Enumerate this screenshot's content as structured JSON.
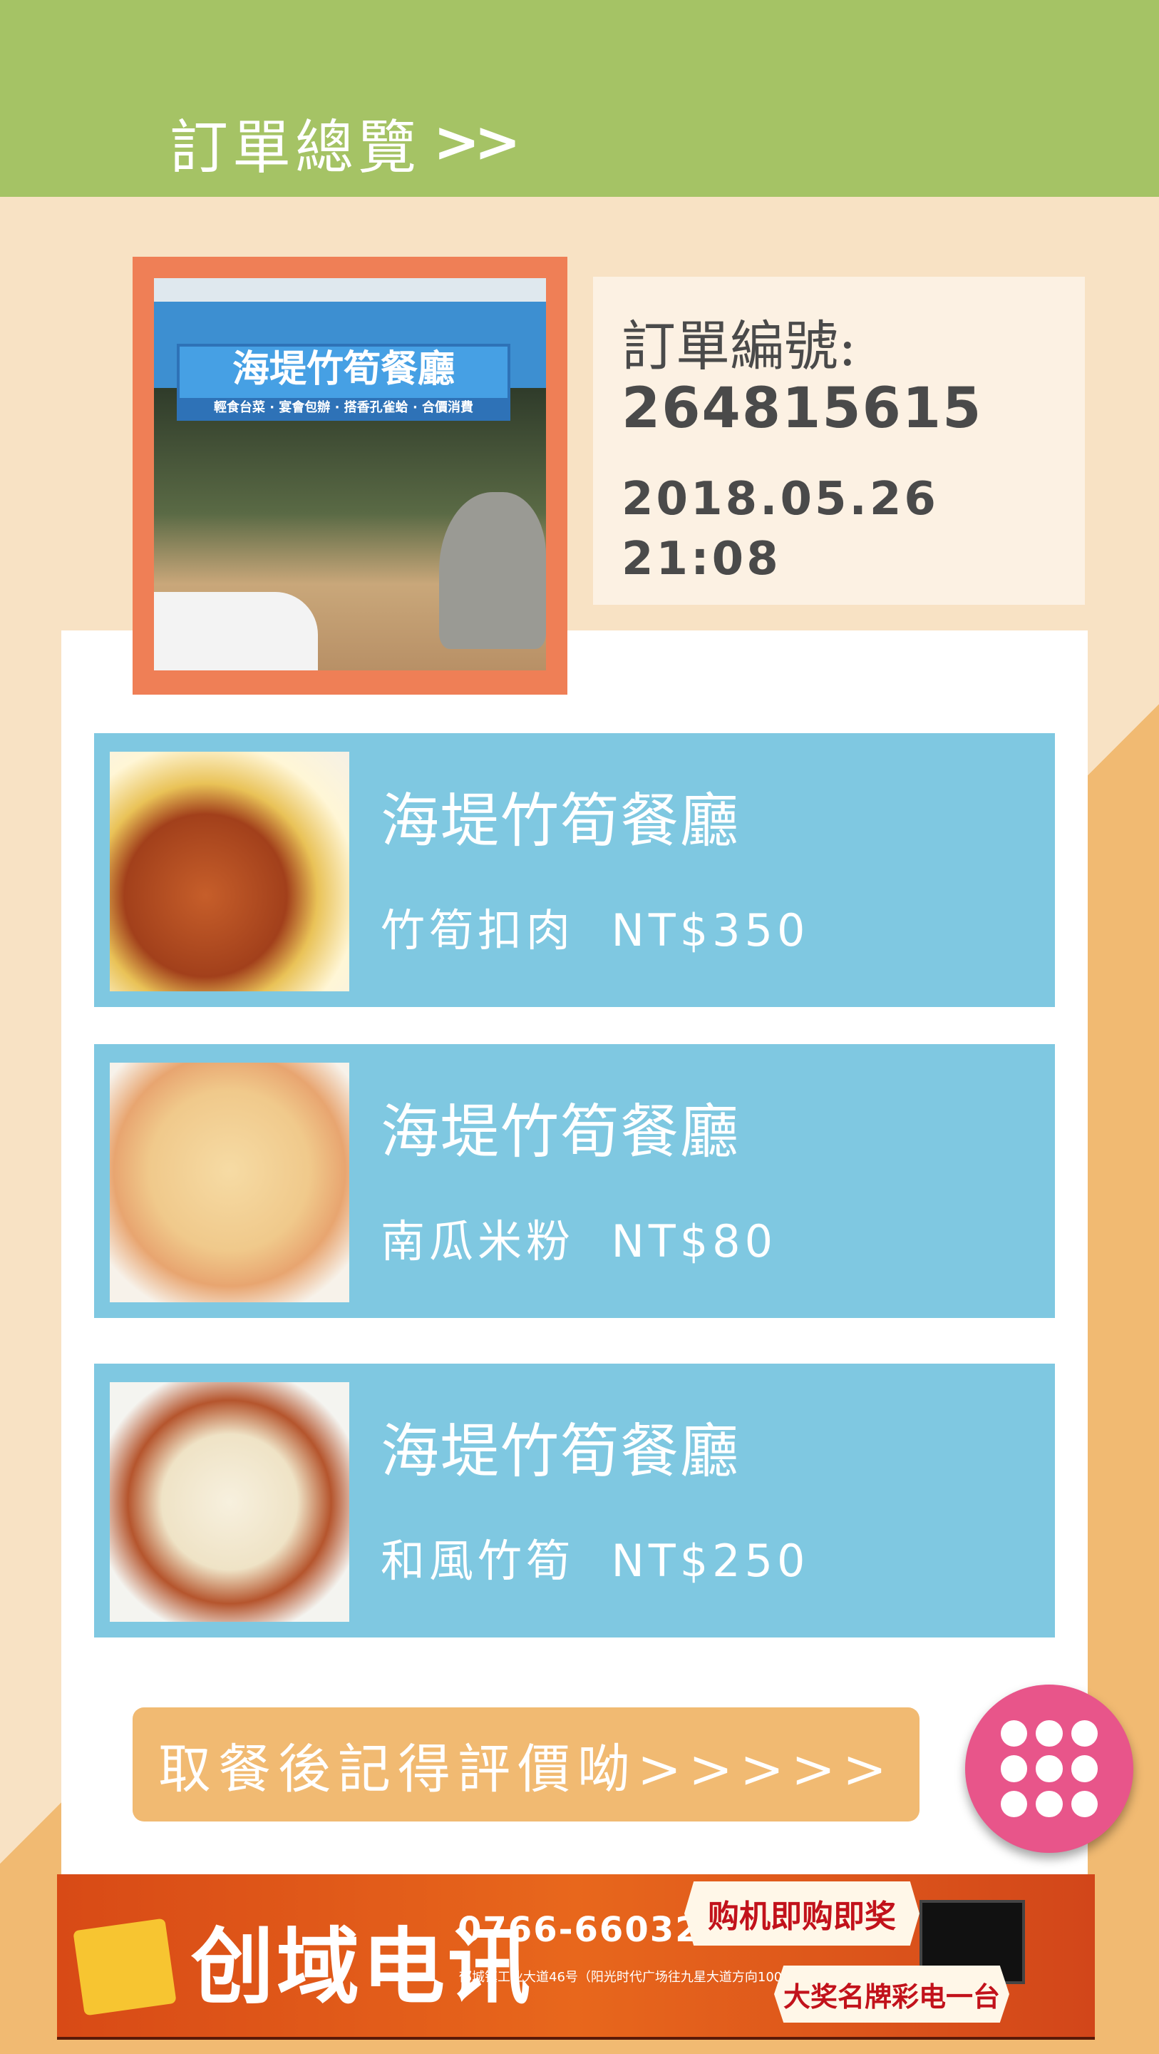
{
  "header": {
    "title": "訂單總覽",
    "chevrons": ">>"
  },
  "restaurant_photo": {
    "sign_text": "海堤竹筍餐廳",
    "sign_sub": "輕食台菜 · 宴會包辦 · 搭香孔雀蛤 · 合價消費"
  },
  "order": {
    "number_label": "訂單編號:",
    "number": "264815615",
    "date": "2018.05.26",
    "time": "21:08"
  },
  "items": [
    {
      "restaurant": "海堤竹筍餐廳",
      "dish": "竹筍扣肉",
      "price": "NT$350"
    },
    {
      "restaurant": "海堤竹筍餐廳",
      "dish": "南瓜米粉",
      "price": "NT$80"
    },
    {
      "restaurant": "海堤竹筍餐廳",
      "dish": "和風竹筍",
      "price": "NT$250"
    }
  ],
  "review_button": "取餐後記得評價呦>>>>>",
  "fab": {
    "icon": "grid-menu-icon"
  },
  "ad": {
    "brand": "创域电讯",
    "phone": "0766-6603268",
    "address": "郁城镇工业大道46号（阳光时代广场往九星大道方向100米）",
    "promo1": "购机即购即奖",
    "promo2": "大奖名牌彩电一台"
  },
  "colors": {
    "header": "#a5c365",
    "frame": "#ef7f56",
    "item_bg": "#7fc8e1",
    "button": "#f1ba72",
    "fab": "#e8558a"
  }
}
